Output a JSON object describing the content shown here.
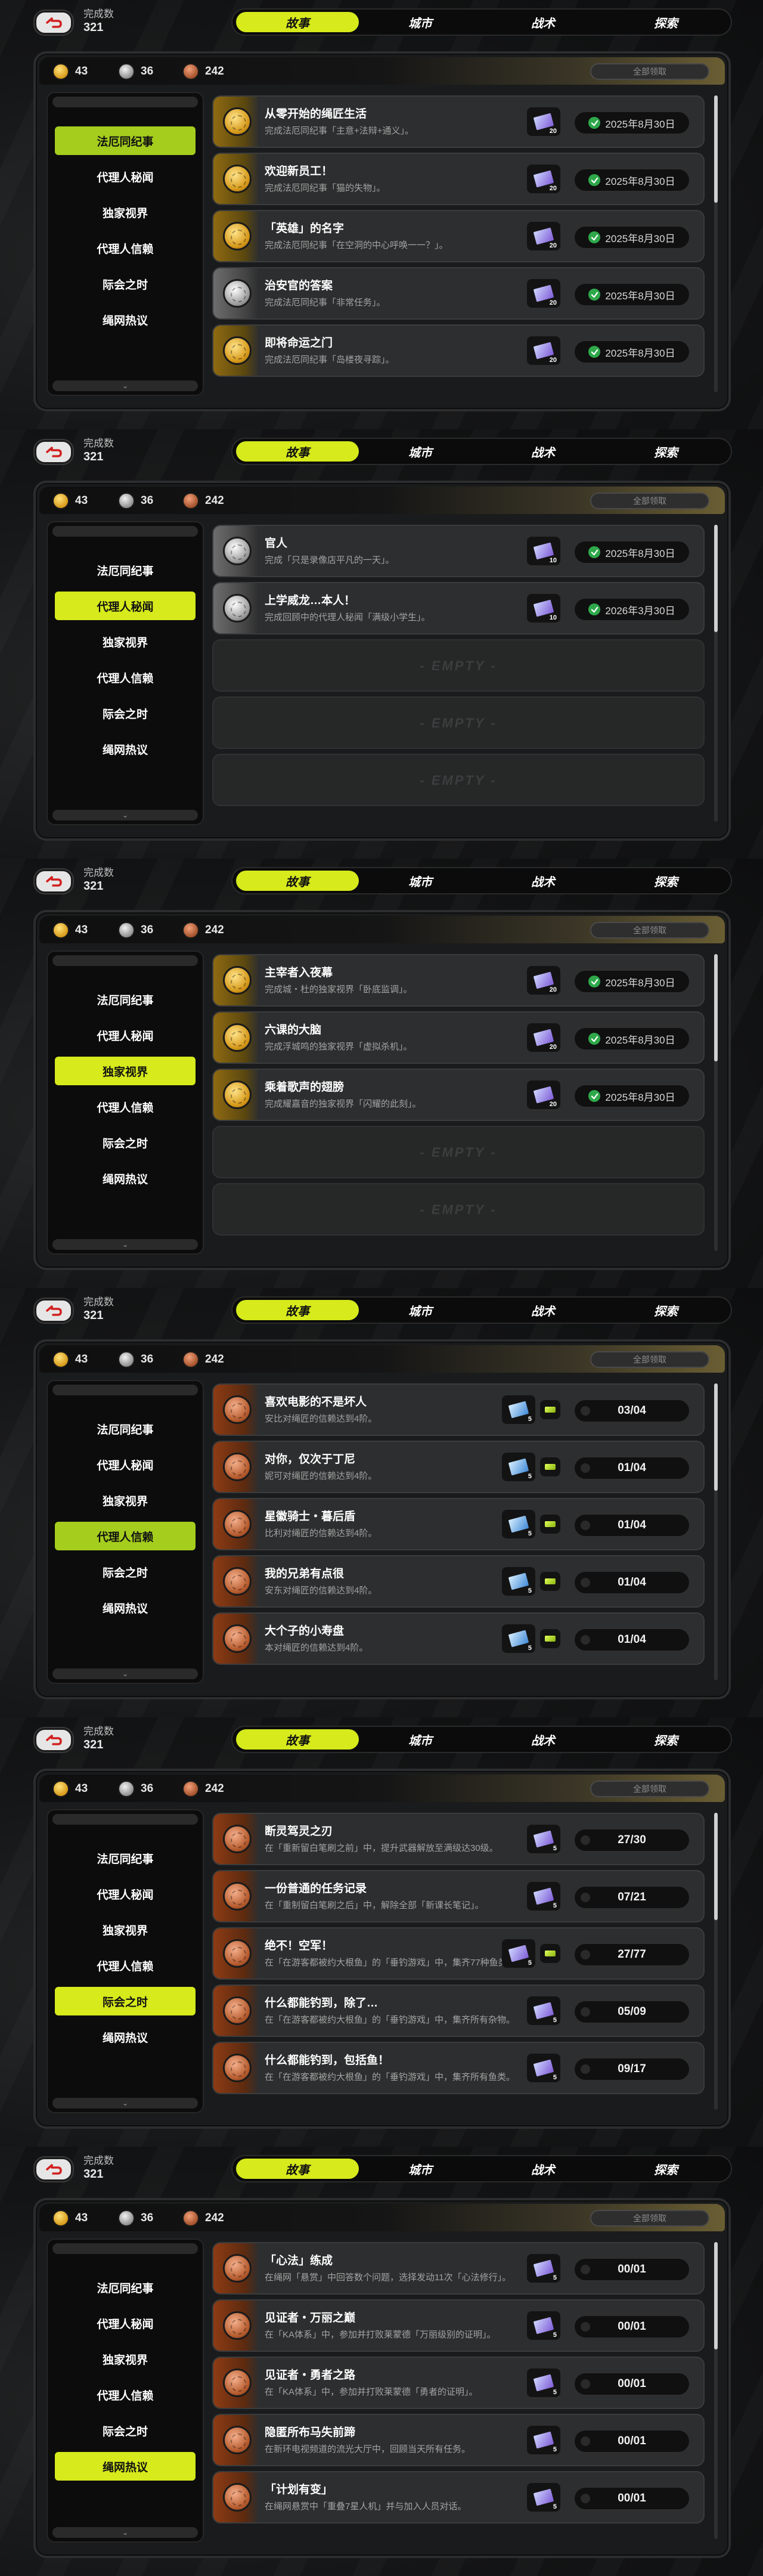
{
  "header": {
    "completion_label": "完成数",
    "completion_value": "321",
    "tabs": [
      "故事",
      "城市",
      "战术",
      "探索"
    ],
    "active_tab": 0
  },
  "currencies": [
    {
      "icon": "gold-coin-icon",
      "value": "43"
    },
    {
      "icon": "silver-coin-icon",
      "value": "36"
    },
    {
      "icon": "bronze-coin-icon",
      "value": "242"
    }
  ],
  "claim_all_label": "全部领取",
  "sidebar_items": [
    "法厄同纪事",
    "代理人秘闻",
    "独家视界",
    "代理人信赖",
    "际会之时",
    "绳网热议"
  ],
  "empty_label": "- EMPTY -",
  "colors": {
    "accent": "#d6ea1c",
    "accent_green": "#a4cd1d",
    "check_green": "#2ea84a"
  },
  "panels": [
    {
      "active_side": 0,
      "rows": [
        {
          "medal": "gold",
          "title": "从零开始的绳匠生活",
          "desc": "完成法厄同纪事「主意+法辩+通义」。",
          "reward": "20",
          "ticket": "purple",
          "date": "2025年8月30日"
        },
        {
          "medal": "gold",
          "title": "欢迎新员工！",
          "desc": "完成法厄同纪事「猫的失物」。",
          "reward": "20",
          "ticket": "purple",
          "date": "2025年8月30日"
        },
        {
          "medal": "gold",
          "title": "「英雄」的名字",
          "desc": "完成法厄同纪事「在空洞的中心呼唤一一？」。",
          "reward": "20",
          "ticket": "purple",
          "date": "2025年8月30日"
        },
        {
          "medal": "silver",
          "title": "治安官的答案",
          "desc": "完成法厄同纪事「非常任务」。",
          "reward": "20",
          "ticket": "purple",
          "date": "2025年8月30日"
        },
        {
          "medal": "gold",
          "title": "即将命运之门",
          "desc": "完成法厄同纪事「岛楼夜寻踪」。",
          "reward": "20",
          "ticket": "purple",
          "date": "2025年8月30日"
        }
      ]
    },
    {
      "active_side": 1,
      "rows": [
        {
          "medal": "silver",
          "title": "官人",
          "desc": "完成「只是录像店平凡的一天」。",
          "reward": "10",
          "ticket": "purple",
          "date": "2025年8月30日"
        },
        {
          "medal": "silver",
          "title": "上学威龙…本人！",
          "desc": "完成回顾中的代理人秘闻「满级小学生」。",
          "reward": "10",
          "ticket": "purple",
          "date": "2026年3月30日"
        }
      ],
      "empty_rows": 3
    },
    {
      "active_side": 2,
      "rows": [
        {
          "medal": "gold",
          "title": "主宰者入夜幕",
          "desc": "完成城・杜的独家视界「卧底监调」。",
          "reward": "20",
          "ticket": "purple",
          "date": "2025年8月30日"
        },
        {
          "medal": "gold",
          "title": "六课的大脑",
          "desc": "完成浮城鸣的独家视界「虚拟杀机」。",
          "reward": "20",
          "ticket": "purple",
          "date": "2025年8月30日"
        },
        {
          "medal": "gold",
          "title": "乘着歌声的翅膀",
          "desc": "完成耀嘉音的独家视界「闪耀的此刻」。",
          "reward": "20",
          "ticket": "purple",
          "date": "2025年8月30日"
        }
      ],
      "empty_rows": 2
    },
    {
      "active_side": 3,
      "rows": [
        {
          "medal": "copper",
          "title": "喜欢电影的不是坏人",
          "desc": "安比对绳匠的信赖达到4阶。",
          "reward": "5",
          "ticket": "blue",
          "progress": "03/04",
          "chip": true
        },
        {
          "medal": "copper",
          "title": "对你，仅次于丁尼",
          "desc": "妮可对绳匠的信赖达到4阶。",
          "reward": "5",
          "ticket": "blue",
          "progress": "01/04",
          "chip": true
        },
        {
          "medal": "copper",
          "title": "星徽骑士・暮后盾",
          "desc": "比利对绳匠的信赖达到4阶。",
          "reward": "5",
          "ticket": "blue",
          "progress": "01/04",
          "chip": true
        },
        {
          "medal": "copper",
          "title": "我的兄弟有点很",
          "desc": "安东对绳匠的信赖达到4阶。",
          "reward": "5",
          "ticket": "blue",
          "progress": "01/04",
          "chip": true
        },
        {
          "medal": "copper",
          "title": "大个子的小寿盘",
          "desc": "本对绳匠的信赖达到4阶。",
          "reward": "5",
          "ticket": "blue",
          "progress": "01/04",
          "chip": true
        }
      ]
    },
    {
      "active_side": 4,
      "rows": [
        {
          "medal": "copper",
          "title": "断灵驾灵之刃",
          "desc": "在「重新留白笔刷之前」中，提升武器解放至满级达30级。",
          "reward": "5",
          "ticket": "purple",
          "progress": "27/30"
        },
        {
          "medal": "copper",
          "title": "一份普通的任务记录",
          "desc": "在「重制留白笔刷之后」中，解除全部「新课长笔记」。",
          "reward": "5",
          "ticket": "purple",
          "progress": "07/21"
        },
        {
          "medal": "copper",
          "title": "绝不！空军！",
          "desc": "在「在游客都被约大根鱼」的「垂钓游戏」中，集齐77种鱼类。",
          "reward": "5",
          "ticket": "purple",
          "progress": "27/77",
          "chip": true
        },
        {
          "medal": "copper",
          "title": "什么都能钓到，除了…",
          "desc": "在「在游客都被约大根鱼」的「垂钓游戏」中，集齐所有杂物。",
          "reward": "5",
          "ticket": "purple",
          "progress": "05/09"
        },
        {
          "medal": "copper",
          "title": "什么都能钓到，包括鱼！",
          "desc": "在「在游客都被约大根鱼」的「垂钓游戏」中，集齐所有鱼类。",
          "reward": "5",
          "ticket": "purple",
          "progress": "09/17"
        }
      ]
    },
    {
      "active_side": 5,
      "rows": [
        {
          "medal": "copper",
          "title": "「心法」练成",
          "desc": "在绳网「悬赏」中回答数个问题，选择发动11次「心法修行」。",
          "reward": "5",
          "ticket": "purple",
          "progress": "00/01"
        },
        {
          "medal": "copper",
          "title": "见证者・万丽之巅",
          "desc": "在「KA体系」中，参加并打败莱蒙德「万丽级别的证明」。",
          "reward": "5",
          "ticket": "purple",
          "progress": "00/01"
        },
        {
          "medal": "copper",
          "title": "见证者・勇者之路",
          "desc": "在「KA体系」中，参加并打败莱蒙德「勇者的证明」。",
          "reward": "5",
          "ticket": "purple",
          "progress": "00/01"
        },
        {
          "medal": "copper",
          "title": "隐匿所布马失前蹄",
          "desc": "在新环电视频道的流光大厅中，回顾当天所有任务。",
          "reward": "5",
          "ticket": "purple",
          "progress": "00/01"
        },
        {
          "medal": "copper",
          "title": "「计划有变」",
          "desc": "在绳网悬赏中「重叠7星人机」并与加入人员对话。",
          "reward": "5",
          "ticket": "purple",
          "progress": "00/01"
        }
      ]
    }
  ]
}
